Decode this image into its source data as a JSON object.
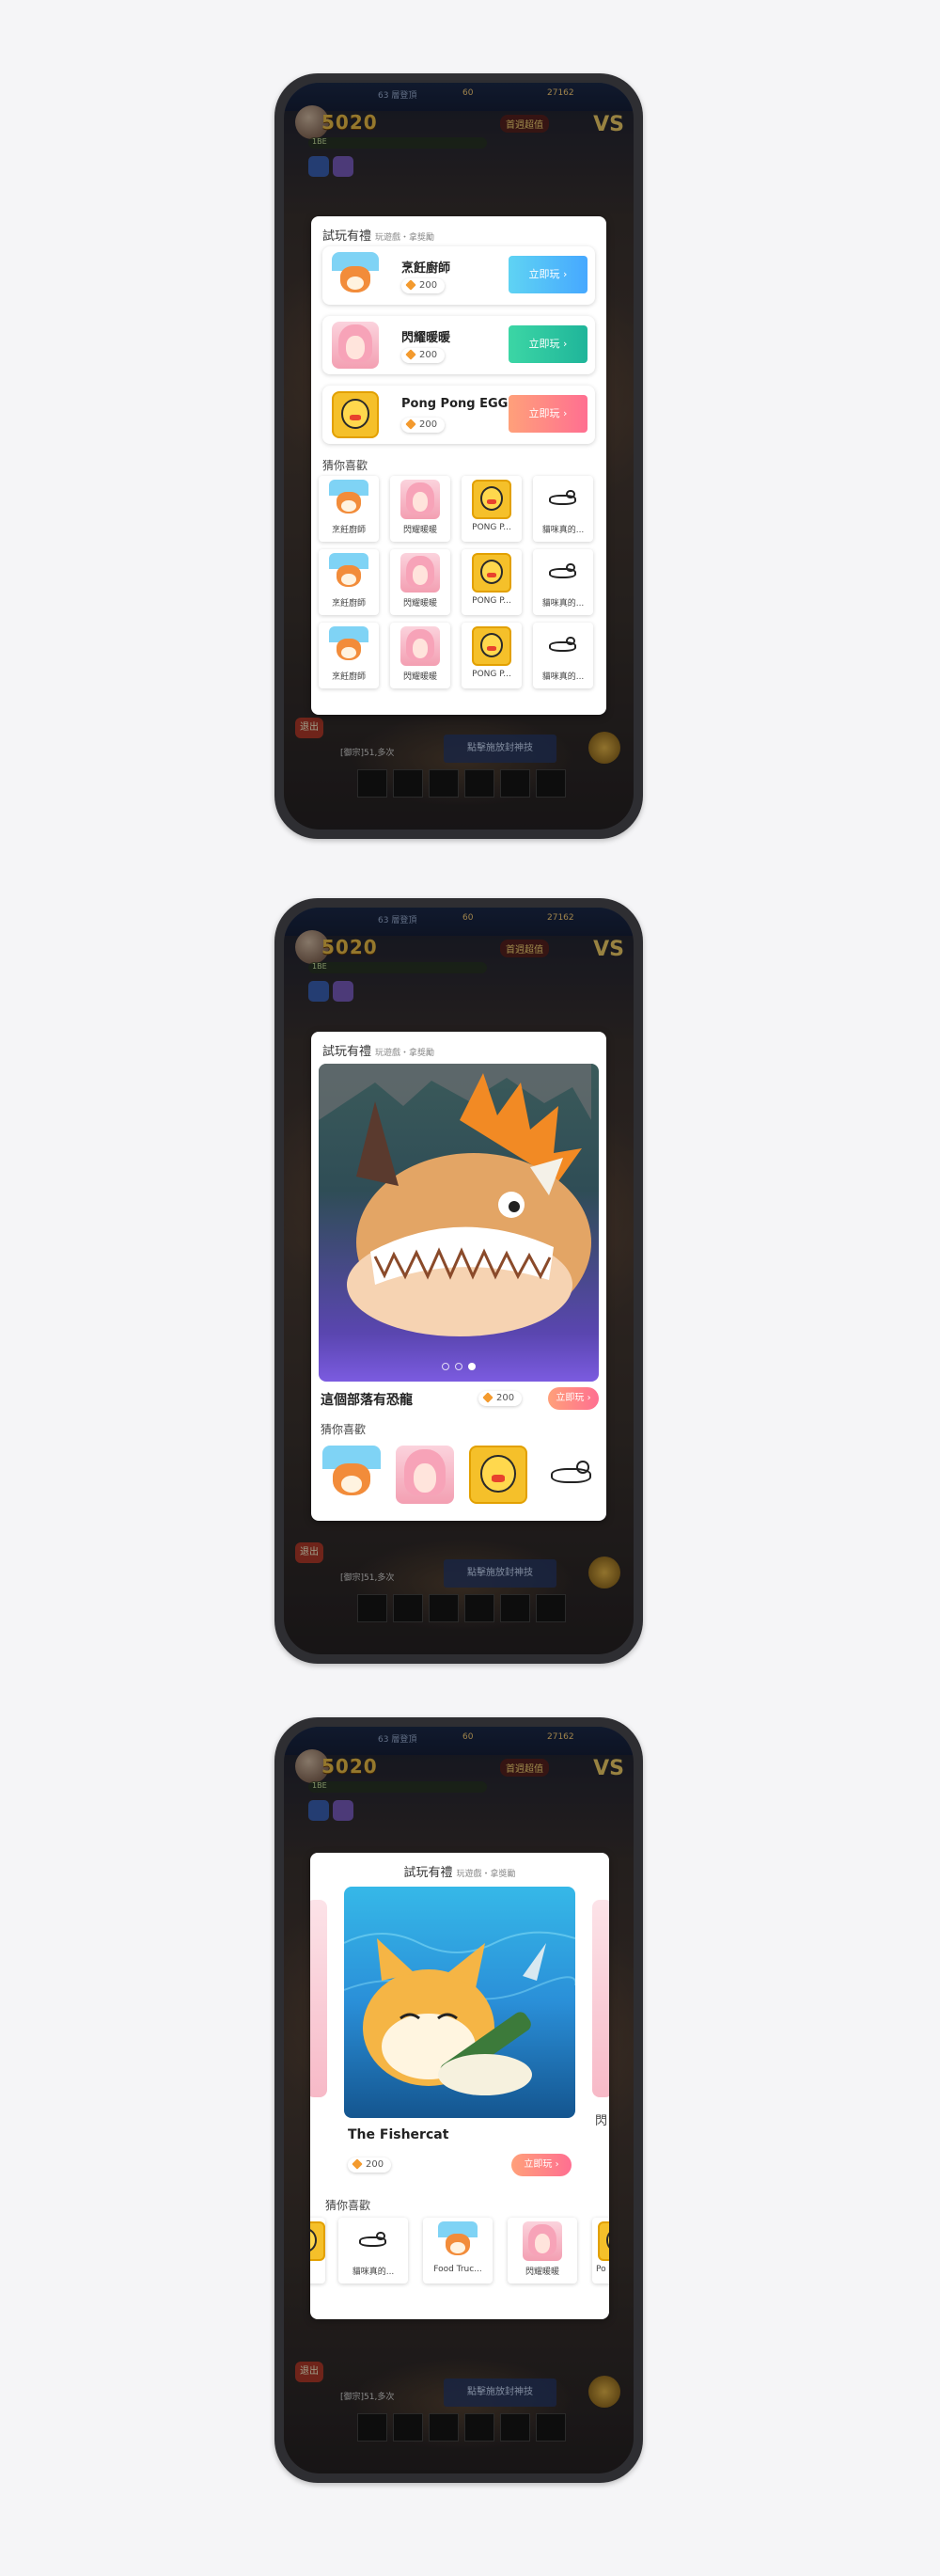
{
  "game_bg": {
    "topbar_mid": "63 層登頂",
    "topbar_coins": "60",
    "topbar_gold": "27162",
    "score": "5020",
    "bubble": "首週超值",
    "status": "1BE",
    "exit": "退出",
    "bottom_button": "點擊施放封神技",
    "chat": "[御宗]51,多次"
  },
  "colors": {
    "blue_button": "#4fc3f7",
    "green_button": "#2ec4a0",
    "coral_button": "#ff8a80",
    "point_gem": "#f39a2e"
  },
  "screen1": {
    "header": "試玩有禮",
    "header_sub": "玩遊戲・拿獎勵",
    "offers": [
      {
        "icon": "shiba-chef-icon",
        "name": "烹飪廚師",
        "points": "200",
        "cta": "立即玩 ›",
        "color": "blue"
      },
      {
        "icon": "pink-hair-girl-icon",
        "name": "閃耀暖暖",
        "points": "200",
        "cta": "立即玩 ›",
        "color": "green"
      },
      {
        "icon": "pong-egg-icon",
        "name": "Pong Pong EGG",
        "points": "200",
        "cta": "立即玩 ›",
        "color": "coral"
      }
    ],
    "recommend_title": "猜你喜歡",
    "grid": [
      [
        "烹飪廚師",
        "閃耀暖暖",
        "PONG P...",
        "貓咪真的..."
      ],
      [
        "烹飪廚師",
        "閃耀暖暖",
        "PONG P...",
        "貓咪真的..."
      ],
      [
        "烹飪廚師",
        "閃耀暖暖",
        "PONG P...",
        "貓咪真的..."
      ]
    ]
  },
  "screen2": {
    "header": "試玩有禮",
    "header_sub": "玩遊戲・拿獎勵",
    "featured_name": "這個部落有恐龍",
    "points": "200",
    "cta": "立即玩 ›",
    "carousel_page": "3 / 3",
    "recommend_title": "猜你喜歡",
    "icons": [
      "shiba-chef-icon",
      "pink-hair-girl-icon",
      "pong-egg-icon",
      "cat-doodle-icon"
    ]
  },
  "screen3": {
    "header": "試玩有禮",
    "header_sub": "玩遊戲・拿獎勵",
    "featured_name": "The Fishercat",
    "points": "200",
    "cta": "立即玩 ›",
    "side_peek_right": "閃",
    "recommend_title": "猜你喜歡",
    "tiles": [
      "貓咪真的...",
      "Food Truc...",
      "閃耀暖暖",
      "Po"
    ]
  }
}
